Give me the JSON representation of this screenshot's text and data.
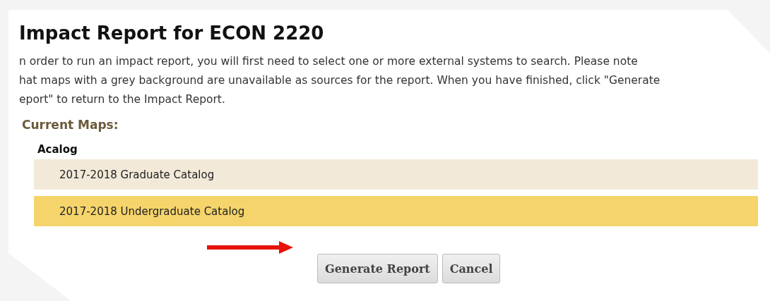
{
  "title": "Impact Report for ECON 2220",
  "intro_lines": [
    "n order to run an impact report, you will first need to select one or more external systems to search. Please note",
    "hat maps with a grey background are unavailable as sources for the report. When you have finished, click \"Generate",
    "eport\" to return to the Impact Report."
  ],
  "section_heading": "Current Maps:",
  "groups": [
    {
      "name": "Acalog",
      "maps": [
        {
          "label": "2017-2018 Graduate Catalog",
          "selected": false
        },
        {
          "label": "2017-2018 Undergraduate Catalog",
          "selected": true
        }
      ]
    }
  ],
  "buttons": [
    "Generate Report",
    "Cancel"
  ]
}
